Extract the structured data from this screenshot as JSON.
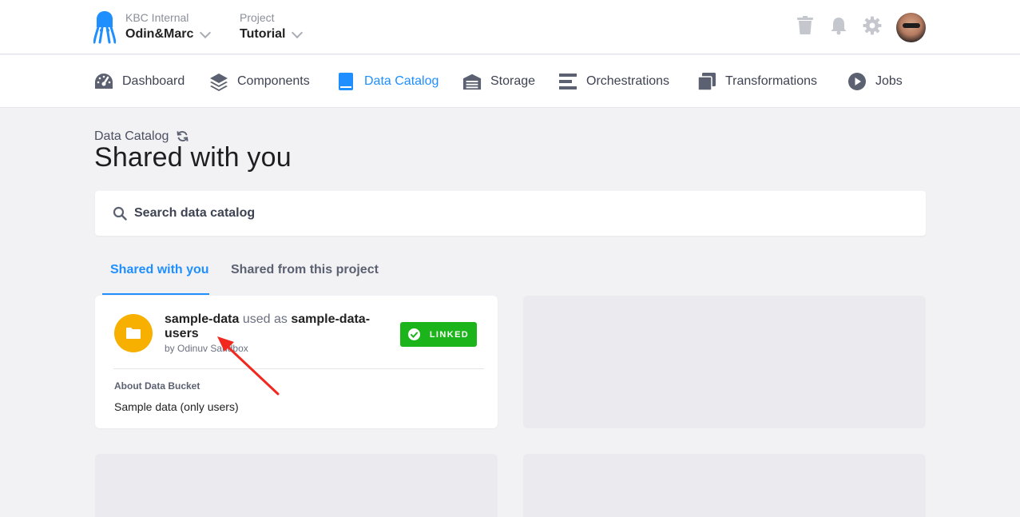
{
  "header": {
    "org_label": "KBC Internal",
    "org_name": "Odin&Marc",
    "project_label": "Project",
    "project_name": "Tutorial",
    "icons": [
      "trash-icon",
      "bell-icon",
      "gear-icon"
    ],
    "avatar": "user-avatar"
  },
  "nav": {
    "items": [
      {
        "label": "Dashboard",
        "icon": "dashboard-gauge-icon"
      },
      {
        "label": "Components",
        "icon": "layers-icon"
      },
      {
        "label": "Data Catalog",
        "icon": "book-icon",
        "active": true
      },
      {
        "label": "Storage",
        "icon": "warehouse-icon"
      },
      {
        "label": "Orchestrations",
        "icon": "bars-icon"
      },
      {
        "label": "Transformations",
        "icon": "copy-icon"
      },
      {
        "label": "Jobs",
        "icon": "play-circle-icon"
      }
    ],
    "active_color": "#1f8fff"
  },
  "page": {
    "breadcrumb": "Data Catalog",
    "title": "Shared with you"
  },
  "search": {
    "placeholder": "Search data catalog"
  },
  "tabs": [
    {
      "label": "Shared with you",
      "active": true
    },
    {
      "label": "Shared from this project",
      "active": false
    }
  ],
  "bucket_card": {
    "name": "sample-data",
    "used_as_text": "used as",
    "alias": "sample-data-users",
    "owner": "by Odinuv Sandbox",
    "status": "LINKED",
    "status_color": "#1bb51b",
    "folder_color": "#f7b000",
    "about_label": "About Data Bucket",
    "about_text": "Sample data (only users)"
  }
}
